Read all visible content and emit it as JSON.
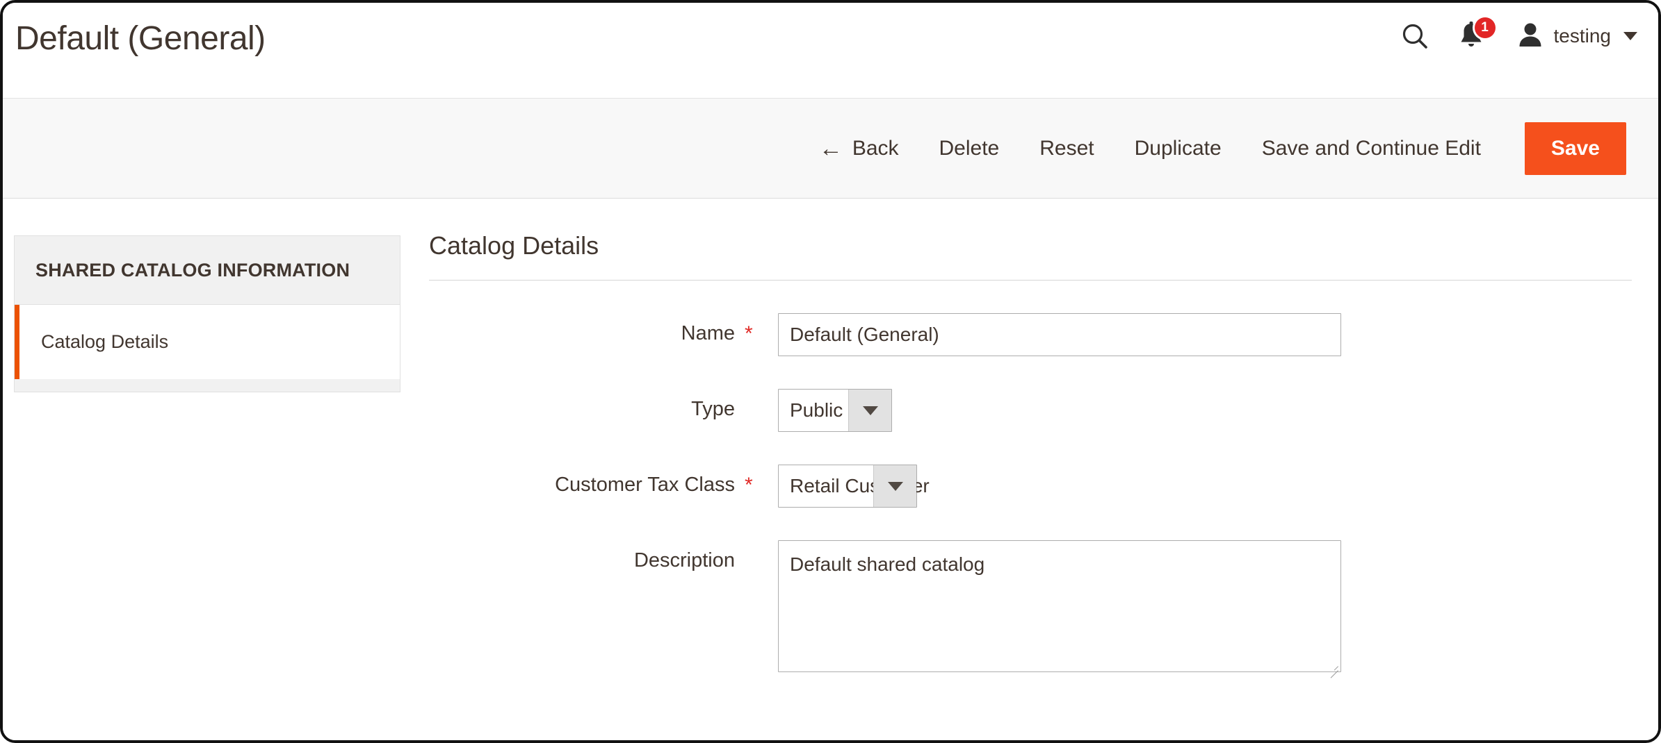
{
  "header": {
    "title": "Default (General)",
    "search_icon": "search-icon",
    "notifications_icon": "bell-icon",
    "notifications_count": "1",
    "user_icon": "user-avatar-icon",
    "user_name": "testing",
    "caret_icon": "chevron-down-icon"
  },
  "toolbar": {
    "back_arrow": "←",
    "back_label": "Back",
    "delete_label": "Delete",
    "reset_label": "Reset",
    "duplicate_label": "Duplicate",
    "save_continue_label": "Save and Continue Edit",
    "save_label": "Save",
    "save_color": "#f5501c"
  },
  "sidebar": {
    "title": "SHARED CATALOG INFORMATION",
    "items": [
      {
        "label": "Catalog Details",
        "active": true
      }
    ],
    "active_marker_color": "#eb5202"
  },
  "main": {
    "section_title": "Catalog Details",
    "fields": {
      "name": {
        "label": "Name",
        "required": "*",
        "value": "Default (General)",
        "placeholder": ""
      },
      "type": {
        "label": "Type",
        "required": "",
        "value": "Public",
        "caret_icon": "chevron-down-icon"
      },
      "tax_class": {
        "label": "Customer Tax Class",
        "required": "*",
        "value": "Retail Customer",
        "caret_icon": "chevron-down-icon"
      },
      "description": {
        "label": "Description",
        "required": "",
        "value": "Default shared catalog",
        "placeholder": ""
      }
    }
  }
}
